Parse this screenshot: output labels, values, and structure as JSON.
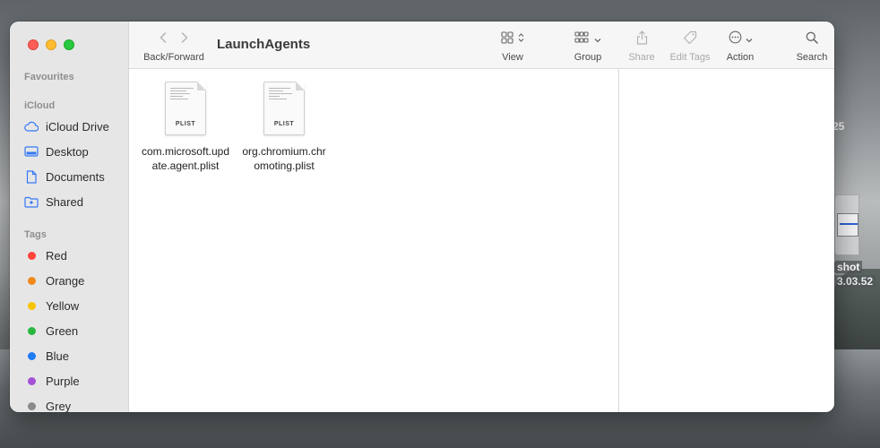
{
  "window": {
    "title": "LaunchAgents"
  },
  "toolbar": {
    "back_forward_label": "Back/Forward",
    "view_label": "View",
    "group_label": "Group",
    "share_label": "Share",
    "edit_tags_label": "Edit Tags",
    "action_label": "Action",
    "search_label": "Search"
  },
  "sidebar": {
    "favourites_heading": "Favourites",
    "icloud_heading": "iCloud",
    "icloud_items": [
      {
        "label": "iCloud Drive",
        "icon": "cloud-icon"
      },
      {
        "label": "Desktop",
        "icon": "desktop-icon"
      },
      {
        "label": "Documents",
        "icon": "document-icon"
      },
      {
        "label": "Shared",
        "icon": "shared-folder-icon"
      }
    ],
    "tags_heading": "Tags",
    "tags": [
      {
        "label": "Red",
        "color": "#ff453a"
      },
      {
        "label": "Orange",
        "color": "#f08a1c"
      },
      {
        "label": "Yellow",
        "color": "#f5c400"
      },
      {
        "label": "Green",
        "color": "#29b83f"
      },
      {
        "label": "Blue",
        "color": "#1f7cf2"
      },
      {
        "label": "Purple",
        "color": "#a551d6"
      },
      {
        "label": "Grey",
        "color": "#8a8a8a"
      }
    ]
  },
  "files": [
    {
      "name": "com.microsoft.update.agent.plist",
      "ext": "PLIST"
    },
    {
      "name": "org.chromium.chromoting.plist",
      "ext": "PLIST"
    }
  ],
  "desktop": {
    "partial_text_top": "25",
    "item_label_line1": "shot",
    "item_label_line2": "3.03.52"
  },
  "colors": {
    "accent": "#3478f6",
    "sidebar_bg": "#e7e6e7",
    "toolbar_bg": "#f6f6f6"
  }
}
